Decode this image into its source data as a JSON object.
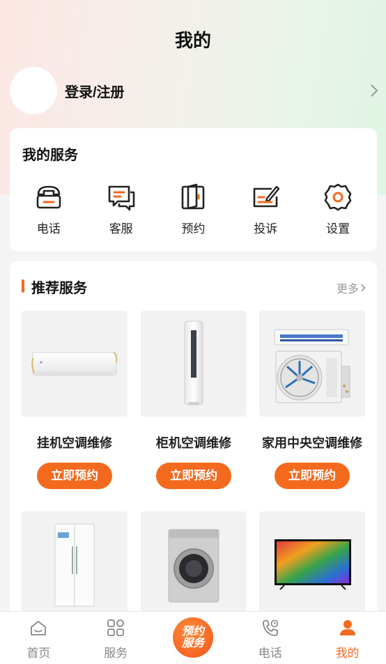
{
  "header": {
    "title": "我的"
  },
  "profile": {
    "login_label": "登录/注册"
  },
  "my_services": {
    "title": "我的服务",
    "items": [
      {
        "label": "电话",
        "icon": "phone-icon"
      },
      {
        "label": "客服",
        "icon": "chat-icon"
      },
      {
        "label": "预约",
        "icon": "booking-icon"
      },
      {
        "label": "投诉",
        "icon": "complaint-icon"
      },
      {
        "label": "设置",
        "icon": "gear-icon"
      }
    ]
  },
  "recommended": {
    "title": "推荐服务",
    "more_label": "更多",
    "items": [
      {
        "name": "挂机空调维修",
        "button": "立即预约",
        "image": "wall-ac-image"
      },
      {
        "name": "柜机空调维修",
        "button": "立即预约",
        "image": "tower-ac-image"
      },
      {
        "name": "家用中央空调维修",
        "button": "立即预约",
        "image": "central-ac-image"
      },
      {
        "image": "refrigerator-image"
      },
      {
        "image": "washing-machine-image"
      },
      {
        "image": "television-image"
      }
    ]
  },
  "tabbar": {
    "items": [
      {
        "label": "首页",
        "icon": "home-icon"
      },
      {
        "label": "服务",
        "icon": "grid-icon"
      },
      {
        "label": "预约服务",
        "center_line1": "预约",
        "center_line2": "服务"
      },
      {
        "label": "电话",
        "icon": "phone-icon"
      },
      {
        "label": "我的",
        "icon": "user-icon",
        "active": true
      }
    ]
  },
  "colors": {
    "accent": "#f36a1f",
    "icon_dark": "#222222"
  }
}
